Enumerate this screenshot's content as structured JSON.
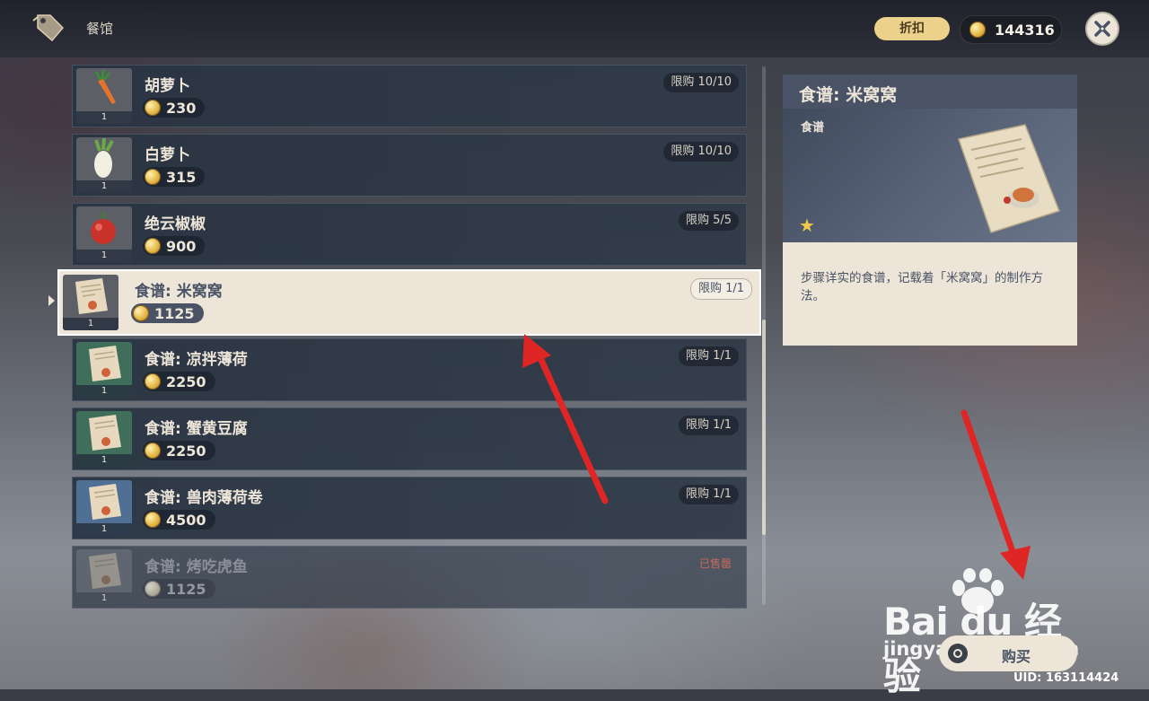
{
  "header": {
    "shop_title": "餐馆",
    "discount_label": "折扣",
    "mora_balance": "144316"
  },
  "items": [
    {
      "name": "胡萝卜",
      "price": "230",
      "limit": "限购 10/10",
      "qty": "1",
      "icon": "carrot-icon"
    },
    {
      "name": "白萝卜",
      "price": "315",
      "limit": "限购 10/10",
      "qty": "1",
      "icon": "radish-icon"
    },
    {
      "name": "绝云椒椒",
      "price": "900",
      "limit": "限购 5/5",
      "qty": "1",
      "icon": "jueyun-chili-icon"
    },
    {
      "name": "食谱: 米窝窝",
      "price": "1125",
      "limit": "限购 1/1",
      "qty": "1",
      "icon": "recipe-icon",
      "selected": true
    },
    {
      "name": "食谱: 凉拌薄荷",
      "price": "2250",
      "limit": "限购 1/1",
      "qty": "1",
      "icon": "recipe-icon"
    },
    {
      "name": "食谱: 蟹黄豆腐",
      "price": "2250",
      "limit": "限购 1/1",
      "qty": "1",
      "icon": "recipe-icon"
    },
    {
      "name": "食谱: 兽肉薄荷卷",
      "price": "4500",
      "limit": "限购 1/1",
      "qty": "1",
      "icon": "recipe-icon"
    },
    {
      "name": "食谱: 烤吃虎鱼",
      "price": "1125",
      "limit": "已售罄",
      "qty": "1",
      "icon": "recipe-icon",
      "sold_out": true
    }
  ],
  "detail": {
    "title": "食谱: 米窝窝",
    "type": "食谱",
    "rarity_stars": 1,
    "description": "步骤详实的食谱，记载着「米窝窝」的制作方法。"
  },
  "buy_button": {
    "label": "购买"
  },
  "uid_text": "UID: 163114424",
  "watermark": {
    "brand": "Bai du 经验",
    "url": "jingyan.baidu.com"
  },
  "colors": {
    "accent": "#ece5d8",
    "gold": "#ecd18b",
    "sold_out": "#e05a40",
    "annotation_arrow": "#e02525"
  }
}
